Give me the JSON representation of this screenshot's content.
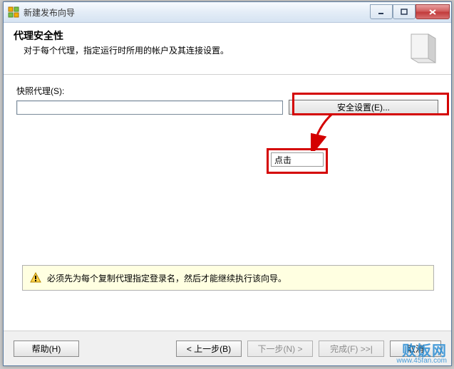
{
  "window": {
    "title": "新建发布向导"
  },
  "header": {
    "title": "代理安全性",
    "description": "对于每个代理，指定运行时所用的帐户及其连接设置。"
  },
  "snapshot": {
    "label": "快照代理(S):",
    "value": "",
    "security_button": "安全设置(E)..."
  },
  "annotation": {
    "click_label": "点击"
  },
  "warning": {
    "text": "必须先为每个复制代理指定登录名，然后才能继续执行该向导。"
  },
  "footer": {
    "help": "帮助(H)",
    "back": "< 上一步(B)",
    "next": "下一步(N) >",
    "finish": "完成(F) >>|",
    "cancel": "取消"
  },
  "watermark": {
    "line1": "败饭网",
    "line2": "www.45fan.com"
  }
}
